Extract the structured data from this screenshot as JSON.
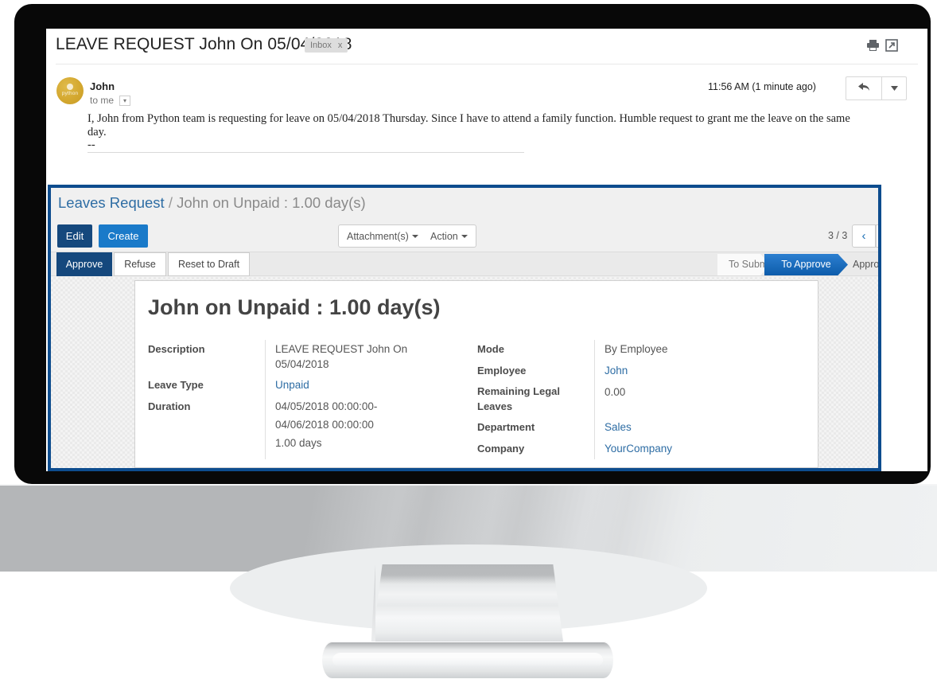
{
  "mail": {
    "subject": "LEAVE REQUEST John On 05/04/2018",
    "label_chip": "Inbox",
    "label_chip_close": "x",
    "print_icon": "⎙",
    "popout_icon": "↗",
    "sender_name": "John",
    "sender_to": "to me",
    "to_caret": "▾",
    "avatar_text": "python",
    "timestamp": "11:56 AM (1 minute ago)",
    "star_icon": "☆",
    "reply_icon": "↰",
    "reply_more_icon": "▼",
    "body": "I, John from  Python team is requesting for leave on 05/04/2018 Thursday. Since  I have to attend a family function. Humble request to grant me the leave on the same day.",
    "signature_dashes": "--"
  },
  "odoo": {
    "breadcrumb": {
      "root": "Leaves Request",
      "separator": "/",
      "current": "John on Unpaid : 1.00 day(s)"
    },
    "controlpanel": {
      "edit": "Edit",
      "create": "Create",
      "attachments": "Attachment(s)",
      "action": "Action",
      "pager_count": "3 / 3",
      "prev_icon": "‹",
      "next_icon": "›"
    },
    "statusbar": {
      "buttons": [
        {
          "label": "Approve",
          "active": true
        },
        {
          "label": "Refuse",
          "active": false
        },
        {
          "label": "Reset to Draft",
          "active": false
        }
      ],
      "stages": [
        {
          "label": "To Submit",
          "active": false
        },
        {
          "label": "To Approve",
          "active": true
        },
        {
          "label": "Approved",
          "active": false
        }
      ]
    },
    "form": {
      "title": "John on Unpaid : 1.00 day(s)",
      "left_fields": [
        {
          "label": "Description",
          "value": "LEAVE REQUEST John On 05/04/2018",
          "link": false
        },
        {
          "label": "Leave Type",
          "value": "Unpaid",
          "link": true
        },
        {
          "label": "Duration",
          "value": "04/05/2018 00:00:00-",
          "link": false
        },
        {
          "label": "",
          "value": "04/06/2018 00:00:00",
          "link": false
        },
        {
          "label": "",
          "value": "1.00 days",
          "link": false
        }
      ],
      "right_fields": [
        {
          "label": "Mode",
          "value": "By Employee",
          "link": false
        },
        {
          "label": "Employee",
          "value": "John",
          "link": true
        },
        {
          "label": "Remaining Legal Leaves",
          "value": "0.00",
          "link": false
        },
        {
          "label": "Department",
          "value": "Sales",
          "link": true
        },
        {
          "label": "Company",
          "value": "YourCompany",
          "link": true
        }
      ],
      "left_labels_split": {
        "description": "Description",
        "leave_type": "Leave Type",
        "duration": "Duration"
      },
      "right_labels_split": {
        "mode": "Mode",
        "employee": "Employee",
        "remaining_1": "Remaining Legal",
        "remaining_2": "Leaves",
        "department": "Department",
        "company": "Company"
      },
      "left_values_split": {
        "desc_1": "LEAVE REQUEST John On",
        "desc_2": "05/04/2018",
        "leave_type": "Unpaid",
        "dur_1": "04/05/2018 00:00:00-",
        "dur_2": "04/06/2018 00:00:00",
        "dur_3": "1.00 days"
      },
      "right_values_split": {
        "mode": "By Employee",
        "employee": "John",
        "remaining": "0.00",
        "department": "Sales",
        "company": "YourCompany"
      }
    }
  },
  "colors": {
    "odoo_border": "#0d4c8e",
    "primary_dark": "#15487d",
    "primary": "#1a7ac9",
    "link": "#2e6da4",
    "avatar": "#d4a82f",
    "bezel": "#080808"
  }
}
